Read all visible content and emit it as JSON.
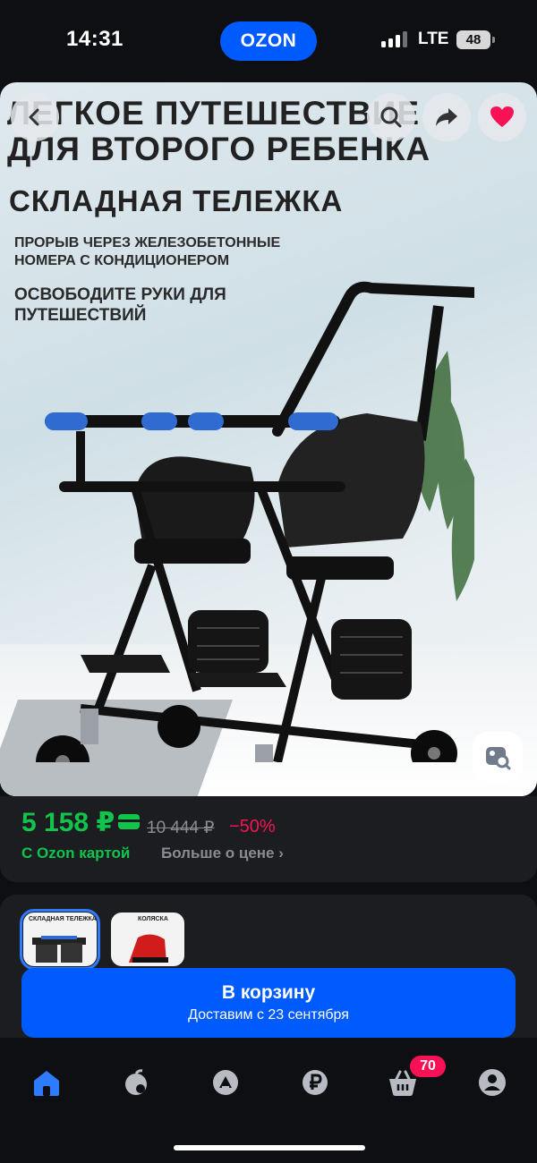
{
  "status_bar": {
    "time": "14:31",
    "app_pill": "OZON",
    "network": "LTE",
    "battery": "48"
  },
  "hero": {
    "headline_1": "ЛЕГКОЕ ПУТЕШЕСТВИЕ",
    "headline_2": "ДЛЯ ВТОРОГО РЕБЕНКА",
    "headline_3": "СКЛАДНАЯ ТЕЛЕЖКА",
    "sub_1": "ПРОРЫВ ЧЕРЕЗ ЖЕЛЕЗОБЕТОННЫЕ НОМЕРА С КОНДИЦИОНЕРОМ",
    "sub_2": "ОСВОБОДИТЕ РУКИ ДЛЯ ПУТЕШЕСТВИЙ",
    "icons": [
      "back-icon",
      "search-icon",
      "share-icon",
      "heart-icon",
      "image-search-icon"
    ]
  },
  "price": {
    "current": "5 158 ₽",
    "old": "10 444 ₽",
    "discount": "−50%",
    "ozon_card_label": "С Ozon картой",
    "more_link": "Больше о цене",
    "colors": {
      "current": "#10c44c",
      "discount": "#f91155"
    }
  },
  "variants": [
    {
      "title": "СКЛАДНАЯ ТЕЛЕЖКА",
      "selected": true
    },
    {
      "title": "КОЛЯСКА",
      "selected": false
    }
  ],
  "cart_button": {
    "label": "В корзину",
    "delivery": "Доставим с 23 сентября",
    "color": "#005bff"
  },
  "tabbar": {
    "items": [
      "home-icon",
      "catalog-icon",
      "favorites-icon",
      "ruble-icon",
      "cart-icon",
      "profile-icon"
    ],
    "cart_badge": "70"
  }
}
